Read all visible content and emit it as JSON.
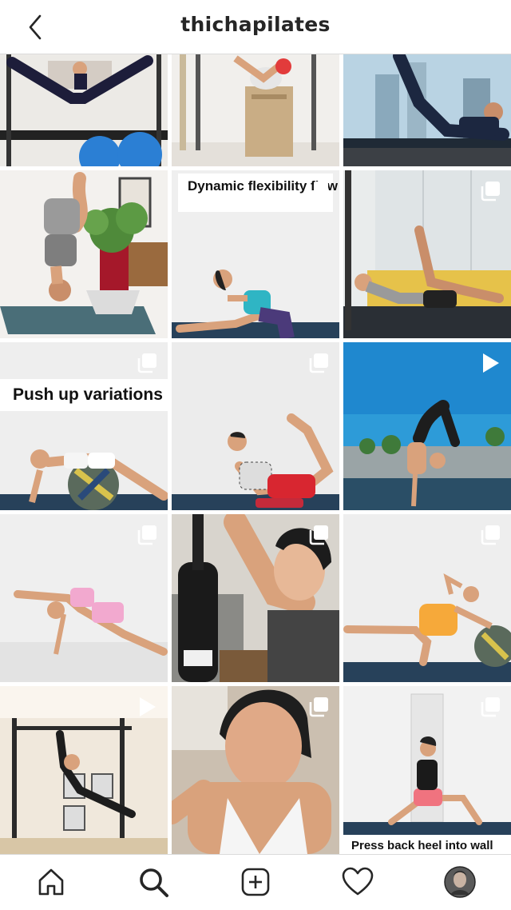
{
  "header": {
    "username": "thichapilates"
  },
  "posts": [
    {
      "type": "image",
      "caption": ""
    },
    {
      "type": "image",
      "caption": ""
    },
    {
      "type": "image",
      "caption": ""
    },
    {
      "type": "image",
      "caption": ""
    },
    {
      "type": "carousel",
      "caption": "Dynamic flexibility flow"
    },
    {
      "type": "carousel",
      "caption": ""
    },
    {
      "type": "carousel",
      "caption": "Push up variations"
    },
    {
      "type": "carousel",
      "caption": ""
    },
    {
      "type": "video",
      "caption": ""
    },
    {
      "type": "carousel",
      "caption": ""
    },
    {
      "type": "carousel",
      "caption": ""
    },
    {
      "type": "carousel",
      "caption": ""
    },
    {
      "type": "video",
      "caption": ""
    },
    {
      "type": "carousel",
      "caption": ""
    },
    {
      "type": "carousel",
      "caption": "Press back heel into wall"
    }
  ],
  "bottom_nav": {
    "items": [
      "home-icon",
      "search-icon",
      "new-post-icon",
      "activity-heart-icon",
      "profile-avatar"
    ]
  }
}
